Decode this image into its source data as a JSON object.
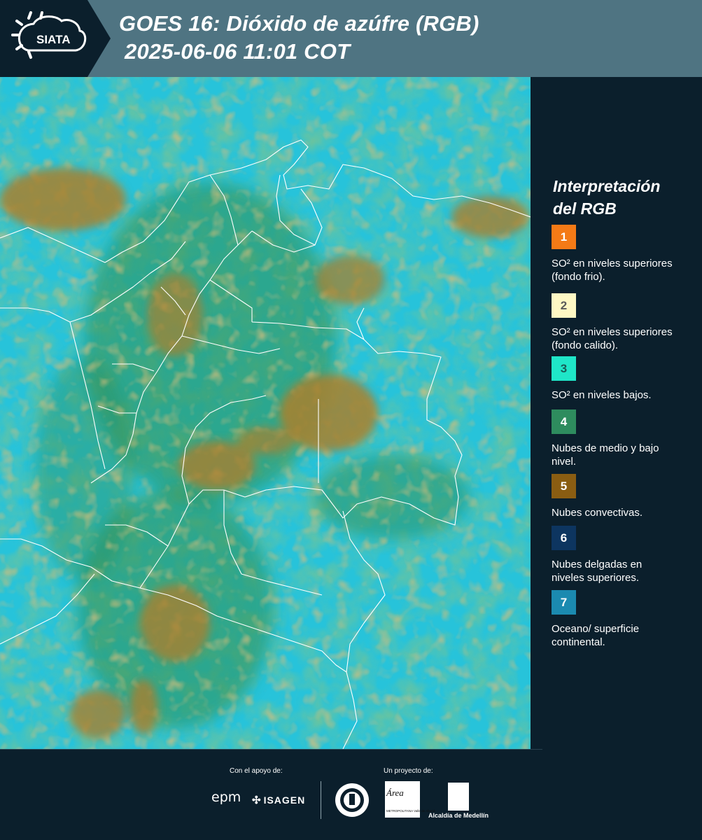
{
  "header": {
    "logo_text": "SIATA",
    "title_line1": "GOES 16: Dióxido de azúfre (RGB)",
    "title_line2": "2025-06-06 11:01 COT",
    "background_color": "#4f7482",
    "logo_background_color": "#0b1f2c"
  },
  "legend": {
    "title_line1": "Interpretación",
    "title_line2": "del RGB",
    "items": [
      {
        "number": "1",
        "color": "#f47a16",
        "number_color": "#ffffff",
        "text": "SO² en niveles superiores (fondo frio)."
      },
      {
        "number": "2",
        "color": "#fff8c4",
        "number_color": "#5b5b5b",
        "text": "SO² en niveles superiores (fondo calido)."
      },
      {
        "number": "3",
        "color": "#1fe6c8",
        "number_color": "#1a5a55",
        "text": "SO² en niveles bajos."
      },
      {
        "number": "4",
        "color": "#2e8c5e",
        "number_color": "#ffffff",
        "text": "Nubes de medio y bajo nivel."
      },
      {
        "number": "5",
        "color": "#8a5d12",
        "number_color": "#ffffff",
        "text": "Nubes convectivas."
      },
      {
        "number": "6",
        "color": "#0d3560",
        "number_color": "#ffffff",
        "text": "Nubes delgadas en niveles superiores."
      },
      {
        "number": "7",
        "color": "#1b8ab0",
        "number_color": "#ffffff",
        "text": "Oceano/ superficie continental."
      }
    ]
  },
  "map": {
    "ocean_color": "#27c3da",
    "cloud_low_color": "#2e8c4a",
    "cloud_convective_color": "#a67a2e",
    "border_color": "#ffffff"
  },
  "footer": {
    "support_label": "Con el apoyo de:",
    "project_label": "Un proyecto de:",
    "sponsor1": "epm",
    "sponsor2": "ISAGEN",
    "partner1": "Área",
    "partner1_sub": "METROPOLITANA Valle de Aburrá",
    "partner2": "Alcaldía de Medellín"
  }
}
